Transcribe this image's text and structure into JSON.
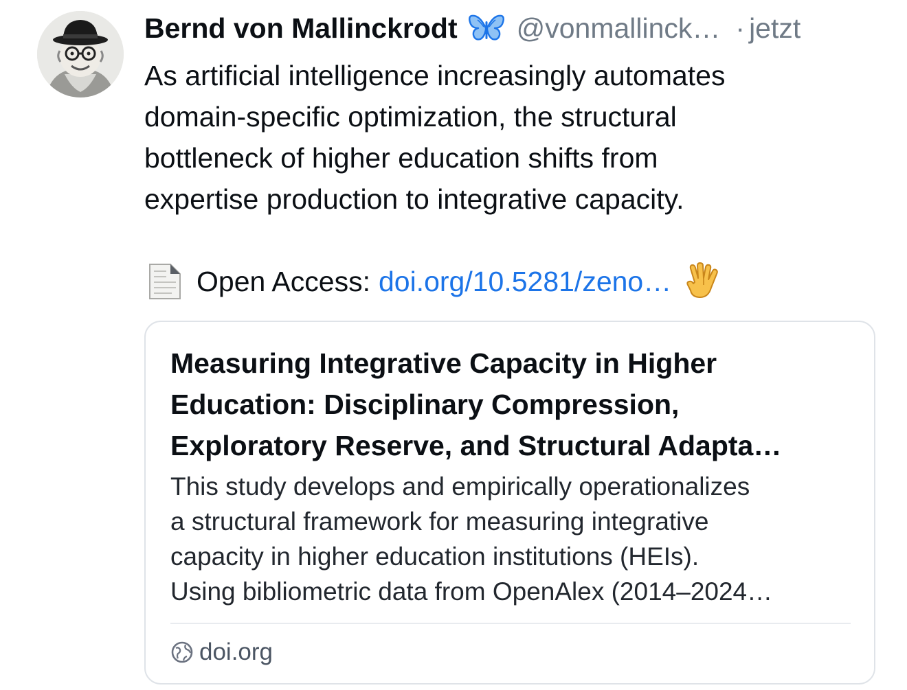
{
  "author": {
    "name": "Bernd von Mallinckrodt",
    "handle": "@vonmallinck…",
    "separator": "·",
    "time": "jetzt",
    "avatar_icon": "avatar-portrait",
    "badge_icon": "butterfly-icon",
    "badge_color": "#1c74e8"
  },
  "post": {
    "text_lines": [
      "As artificial intelligence increasingly automates",
      "domain-specific optimization, the structural",
      "bottleneck of higher education shifts from",
      "expertise production to integrative capacity."
    ],
    "access_label": "Open Access:",
    "access_link": "doi.org/10.5281/zeno…",
    "doc_icon": "page-facing-up-icon",
    "trailing_icon": "vulcan-salute-icon",
    "link_color": "#1c74e8"
  },
  "card": {
    "title_lines": [
      "Measuring Integrative Capacity in Higher",
      "Education: Disciplinary Compression,",
      "Exploratory Reserve, and Structural Adapta…"
    ],
    "description_lines": [
      "This study develops and empirically operationalizes",
      "a structural framework for measuring integrative",
      "capacity in higher education institutions (HEIs).",
      "Using bibliometric data from OpenAlex (2014–2024…"
    ],
    "source": "doi.org",
    "source_icon": "globe-icon"
  }
}
